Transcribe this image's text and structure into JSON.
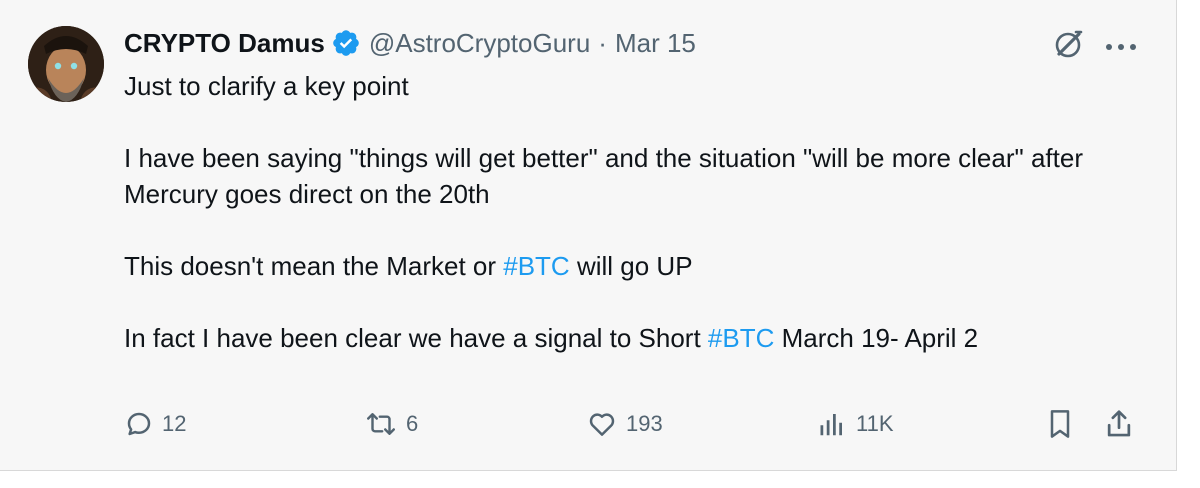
{
  "author": {
    "name": "CRYPTO Damus",
    "handle": "@AstroCryptoGuru",
    "separator": "·",
    "date": "Mar 15"
  },
  "tweet": {
    "line1": "Just to clarify a key point",
    "line2": "I have been saying  \"things will get better\" and the situation \"will be more clear\" after Mercury goes direct on the 20th",
    "line3_pre": "This doesn't mean the Market or ",
    "line3_tag": "#BTC",
    "line3_post": " will go UP",
    "line4_pre": "In fact I have been clear we have a signal to Short ",
    "line4_tag": "#BTC",
    "line4_post": " March 19- April 2"
  },
  "actions": {
    "replies": "12",
    "reposts": "6",
    "likes": "193",
    "views": "11K"
  },
  "colors": {
    "hashtag": "#1d9bf0",
    "verified": "#1d9bf0",
    "secondary_text": "#536471",
    "primary_text": "#0f1419"
  },
  "icons": [
    "grok-icon",
    "more-icon",
    "verified-badge-icon",
    "reply-icon",
    "repost-icon",
    "like-icon",
    "views-icon",
    "bookmark-icon",
    "share-icon"
  ]
}
